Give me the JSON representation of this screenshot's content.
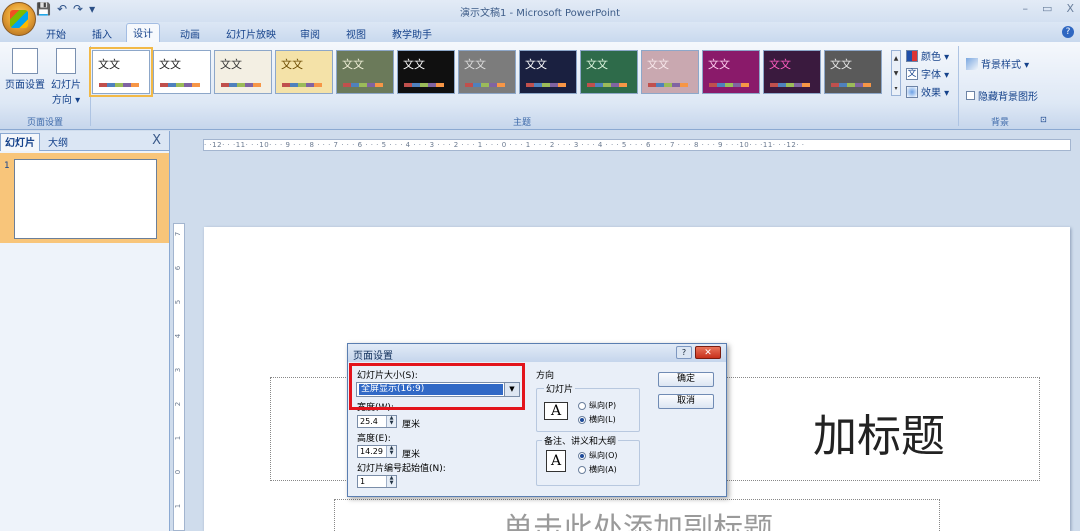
{
  "window": {
    "title": "演示文稿1 - Microsoft PowerPoint",
    "min": "–",
    "max": "▭",
    "close": "X"
  },
  "qat": {
    "save": "💾",
    "undo": "↶",
    "redo": "↷",
    "more": "▾"
  },
  "tabs": [
    "开始",
    "插入",
    "设计",
    "动画",
    "幻灯片放映",
    "审阅",
    "视图",
    "教学助手"
  ],
  "active_tab": "设计",
  "ribbon": {
    "page_setup_label": "页面设置",
    "orientation_label": "幻灯片",
    "orientation_sub": "方向 ▾",
    "group_page_setup": "页面设置",
    "group_themes": "主题",
    "group_background": "背景",
    "theme_sample": "文文",
    "colors": "颜色 ▾",
    "fonts": "字体 ▾",
    "effects": "效果 ▾",
    "bg_styles": "背景样式 ▾",
    "hide_bg": "隐藏背景图形"
  },
  "themes": [
    {
      "bg": "#ffffff",
      "fg": "#222222",
      "selected": true
    },
    {
      "bg": "#ffffff",
      "fg": "#222222"
    },
    {
      "bg": "#f3efe3",
      "fg": "#333333"
    },
    {
      "bg": "#f4e2a8",
      "fg": "#6b4b00"
    },
    {
      "bg": "#6b7a5a",
      "fg": "#f0f0d8"
    },
    {
      "bg": "#101010",
      "fg": "#ffffff"
    },
    {
      "bg": "#7c7c7c",
      "fg": "#dddddd"
    },
    {
      "bg": "#1a2040",
      "fg": "#ffffff"
    },
    {
      "bg": "#2e6b4a",
      "fg": "#dff5df"
    },
    {
      "bg": "#c9a8b0",
      "fg": "#f8e8ec"
    },
    {
      "bg": "#8a1a6a",
      "fg": "#ffd0f0"
    },
    {
      "bg": "#3a1a3e",
      "fg": "#ff5cc0"
    },
    {
      "bg": "#5a5a5a",
      "fg": "#e8e8e8"
    }
  ],
  "left_pane": {
    "tab_slides": "幻灯片",
    "tab_outline": "大纲",
    "close": "X",
    "slide_number": "1"
  },
  "ruler": {
    "h": "· ·12· · ·11· · ·10· · · 9 · · · 8 · · · 7 · · · 6 · · · 5 · · · 4 · · · 3 · · · 2 · · · 1 · · · 0 · · · 1 · · · 2 · · · 3 · · · 4 · · · 5 · · · 6 · · · 7 · · · 8 · · · 9 · · ·10· · ·11· · ·12· ·"
  },
  "slide": {
    "title_visible": "加标题",
    "subtitle_visible": "单击此处添加副标题"
  },
  "dialog": {
    "title": "页面设置",
    "help": "?",
    "close": "✕",
    "size_label": "幻灯片大小(S):",
    "size_value": "全屏显示(16:9)",
    "width_label": "宽度(W):",
    "width_value": "25.4",
    "width_unit": "厘米",
    "height_label": "高度(E):",
    "height_value": "14.29",
    "height_unit": "厘米",
    "start_label": "幻灯片编号起始值(N):",
    "start_value": "1",
    "orientation": "方向",
    "slides_group": "幻灯片",
    "portrait_p": "纵向(P)",
    "landscape_l": "横向(L)",
    "notes_group": "备注、讲义和大纲",
    "portrait_o": "纵向(O)",
    "landscape_a": "横向(A)",
    "ok": "确定",
    "cancel": "取消"
  }
}
